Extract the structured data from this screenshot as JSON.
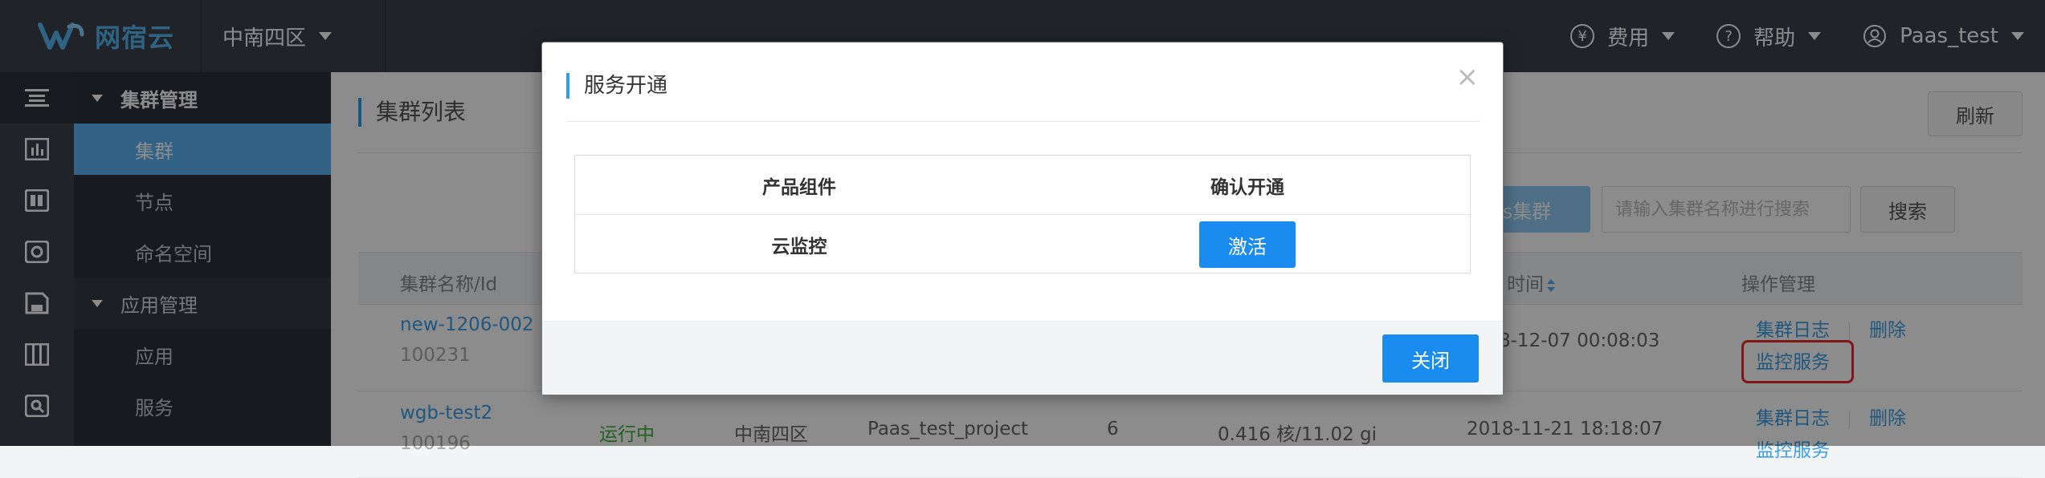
{
  "topbar": {
    "logo_text": "网宿云",
    "region": "中南四区",
    "fee": "费用",
    "help": "帮助",
    "user": "Paas_test",
    "fee_symbol": "¥",
    "help_symbol": "?"
  },
  "sidebar": {
    "group1": "集群管理",
    "items1": [
      "集群",
      "节点",
      "命名空间"
    ],
    "group2": "应用管理",
    "items2": [
      "应用",
      "服务"
    ]
  },
  "main": {
    "title": "集群列表",
    "refresh": "刷新",
    "create_btn_partial": "s集群",
    "search_placeholder": "请输入集群名称进行搜索",
    "search_btn": "搜索",
    "headers": {
      "name_id": "集群名称/Id",
      "time_partial": "时间",
      "ops": "操作管理"
    },
    "rows": [
      {
        "name": "new-1206-002",
        "id": "100231",
        "time": "8-12-07 00:08:03",
        "op_log": "集群日志",
        "op_delete": "删除",
        "op_monitor": "监控服务"
      },
      {
        "name": "wgb-test2",
        "id": "100196",
        "status": "运行中",
        "region": "中南四区",
        "project": "Paas_test_project",
        "nodes": "6",
        "resources": "0.416 核/11.02 gi",
        "time": "2018-11-21 18:18:07",
        "op_log": "集群日志",
        "op_delete": "删除",
        "op_monitor": "监控服务"
      }
    ]
  },
  "modal": {
    "title": "服务开通",
    "close_x": "×",
    "col_component": "产品组件",
    "col_confirm": "确认开通",
    "row_component": "云监控",
    "activate": "激活",
    "close": "关闭"
  },
  "colors": {
    "topbar": "#3b4249",
    "accent": "#1a8cf0",
    "sidebar_active": "#5bb5f5",
    "highlight": "#e62b2b",
    "status_green": "#3cb035"
  }
}
